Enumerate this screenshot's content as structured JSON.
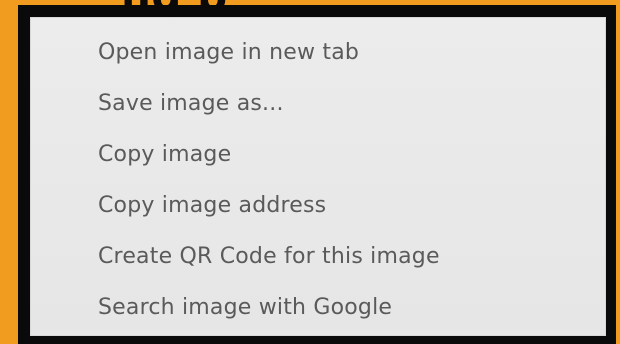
{
  "context_menu": {
    "items": [
      {
        "label": "Open image in new tab"
      },
      {
        "label": "Save image as..."
      },
      {
        "label": "Copy image"
      },
      {
        "label": "Copy image address"
      },
      {
        "label": "Create QR Code for this image"
      },
      {
        "label": "Search image with Google"
      }
    ]
  },
  "colors": {
    "background_accent": "#f29c1f",
    "frame": "#0a0a0a",
    "menu_background": "#e9e9e9",
    "menu_text": "#5a5a5a"
  }
}
